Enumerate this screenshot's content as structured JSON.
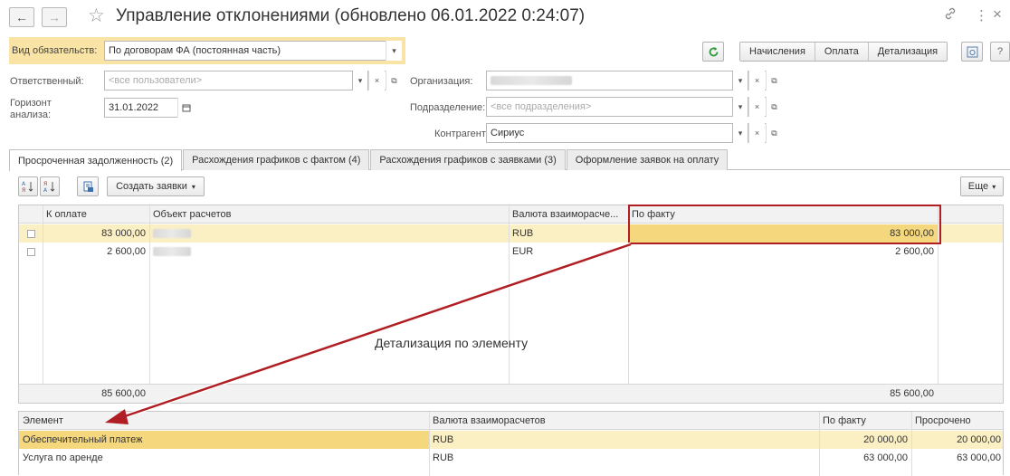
{
  "window": {
    "title": "Управление отклонениями (обновлено 06.01.2022 0:24:07)",
    "back_icon": "←",
    "forward_icon": "→",
    "link_icon": "🔗",
    "more_icon": "⋮",
    "close_icon": "×"
  },
  "filters": {
    "obligation_label": "Вид обязательств:",
    "obligation_value": "По договорам ФА (постоянная часть)",
    "responsible_label": "Ответственный:",
    "responsible_placeholder": "<все пользователи>",
    "horizon_label": "Горизонт анализа:",
    "horizon_value": "31.01.2022",
    "organization_label": "Организация:",
    "division_label": "Подразделение:",
    "division_placeholder": "<все подразделения>",
    "counterparty_label": "Контрагент:",
    "counterparty_value": "Сириус"
  },
  "toolbar_top": {
    "segments": [
      "Начисления",
      "Оплата",
      "Детализация"
    ]
  },
  "tabs": [
    "Просроченная задолженность (2)",
    "Расхождения графиков с фактом (4)",
    "Расхождения графиков с заявками (3)",
    "Оформление заявок на оплату"
  ],
  "grid_toolbar": {
    "create_label": "Создать заявки",
    "more_label": "Еще"
  },
  "main_table": {
    "columns": [
      "К оплате",
      "Объект расчетов",
      "Валюта взаиморасче...",
      "По факту"
    ],
    "rows": [
      {
        "to_pay": "83 000,00",
        "currency": "RUB",
        "fact": "83 000,00"
      },
      {
        "to_pay": "2 600,00",
        "currency": "EUR",
        "fact": "2 600,00"
      }
    ],
    "total_to_pay": "85 600,00",
    "total_fact": "85 600,00"
  },
  "annotation": "Детализация по элементу",
  "detail_table": {
    "columns": [
      "Элемент",
      "Валюта взаиморасчетов",
      "По факту",
      "Просрочено"
    ],
    "rows": [
      {
        "element": "Обеспечительный платеж",
        "currency": "RUB",
        "fact": "20 000,00",
        "overdue": "20 000,00"
      },
      {
        "element": "Услуга по аренде",
        "currency": "RUB",
        "fact": "63 000,00",
        "overdue": "63 000,00"
      }
    ]
  },
  "colors": {
    "selected_row": "#fbefc4",
    "highlight_cell": "#f5d77e",
    "arrow": "#b01e23",
    "obligation_bg": "#f9e4a6"
  }
}
